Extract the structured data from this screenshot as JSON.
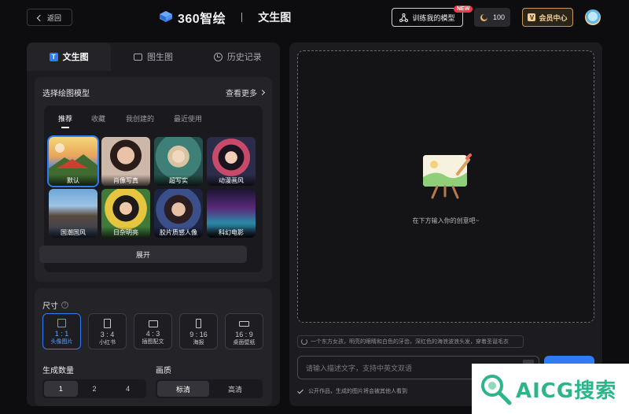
{
  "header": {
    "back_label": "返回",
    "brand_name": "360智绘",
    "brand_sub": "文生图",
    "train_label": "训练我的模型",
    "new_badge": "NEW",
    "credits": "100",
    "vip_label": "会员中心",
    "vip_icon_letter": "V"
  },
  "tabs": [
    {
      "label": "文生图",
      "icon": "T"
    },
    {
      "label": "图生图"
    },
    {
      "label": "历史记录"
    }
  ],
  "model_section": {
    "title": "选择绘图模型",
    "more_label": "查看更多",
    "sub_tabs": [
      "推荐",
      "收藏",
      "我创建的",
      "最近使用"
    ],
    "models": [
      {
        "label": "默认"
      },
      {
        "label": "肖像写真"
      },
      {
        "label": "超写实"
      },
      {
        "label": "动漫画风"
      },
      {
        "label": "国潮国风"
      },
      {
        "label": "日杂明亮"
      },
      {
        "label": "胶片质感人像"
      },
      {
        "label": "科幻电影"
      }
    ],
    "expand_label": "展开"
  },
  "size_section": {
    "title": "尺寸",
    "help_glyph": "?",
    "ratios": [
      {
        "value": "1 : 1",
        "name": "头像图片"
      },
      {
        "value": "3 : 4",
        "name": "小红书"
      },
      {
        "value": "4 : 3",
        "name": "插图配文"
      },
      {
        "value": "9 : 16",
        "name": "海报"
      },
      {
        "value": "16 : 9",
        "name": "桌面壁纸"
      }
    ],
    "count_label": "生成数量",
    "counts": [
      "1",
      "2",
      "4"
    ],
    "quality_label": "画质",
    "qualities": [
      "标清",
      "高清"
    ]
  },
  "canvas": {
    "hint": "在下方输入你的创意吧~",
    "suggestion": "一个东方女孩，明亮的眼睛和白色的牙齿，深红色的海浪波浪头发，穿着圣诞毛衣",
    "prompt_placeholder": "请输入描述文字，支持中英文双语",
    "generate_label": "生成",
    "public_label": "公开作品，生成的图片将会被其他人看到"
  },
  "watermark": {
    "text": "AICG搜索"
  },
  "colors": {
    "accent": "#2f7cf6",
    "vip_gold": "#f1cf94",
    "badge_red": "#ef3a4b",
    "watermark_green": "#2cb58a"
  }
}
